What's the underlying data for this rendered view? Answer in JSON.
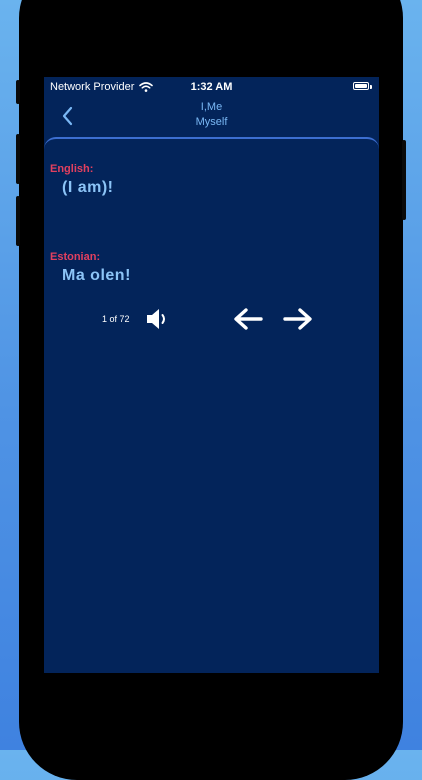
{
  "status_bar": {
    "carrier": "Network Provider",
    "time": "1:32 AM",
    "wifi_icon": "wifi-icon",
    "battery_icon": "battery-icon",
    "battery_level": 1.0
  },
  "nav": {
    "title_line1": "I,Me",
    "title_line2": "Myself",
    "back_icon": "chevron-left-icon"
  },
  "phrase": {
    "source_label": "English:",
    "source_text": "(I am)!",
    "target_label": "Estonian:",
    "target_text": "Ma olen!"
  },
  "controls": {
    "counter": "1 of 72",
    "speaker_icon": "speaker-icon",
    "prev_icon": "arrow-left-icon",
    "next_icon": "arrow-right-icon"
  },
  "colors": {
    "background_gradient_top": "#6ab3ee",
    "background_gradient_bottom": "#3f82e0",
    "screen": "#03245a",
    "label_accent": "#e2405f",
    "text_accent": "#8cc4f7",
    "title_accent": "#7ab8f5",
    "card_border": "#3c6ed0"
  }
}
